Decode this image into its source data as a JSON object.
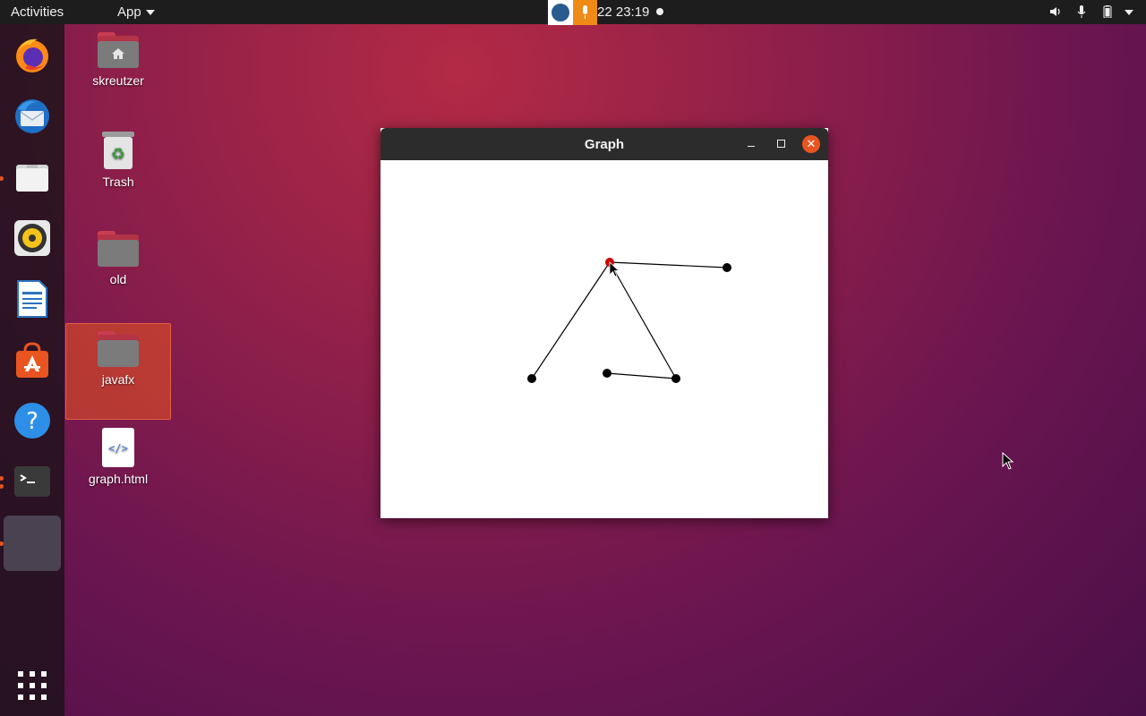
{
  "topbar": {
    "activities": "Activities",
    "app_menu": "App",
    "clock": "22  23:19"
  },
  "dock": {
    "items": [
      {
        "icon": "firefox-icon",
        "running": false
      },
      {
        "icon": "thunderbird-icon",
        "running": false
      },
      {
        "icon": "files-icon",
        "running": true
      },
      {
        "icon": "rhythmbox-icon",
        "running": false
      },
      {
        "icon": "libreoffice-writer-icon",
        "running": false
      },
      {
        "icon": "software-center-icon",
        "running": false
      },
      {
        "icon": "help-icon",
        "running": false
      },
      {
        "icon": "terminal-icon",
        "running": true,
        "instances": 2
      },
      {
        "icon": "java-app-icon",
        "running": true,
        "active": true
      }
    ],
    "show_apps_icon": "app-grid-icon"
  },
  "desktop": {
    "icons": [
      {
        "label": "skreutzer",
        "type": "home-folder"
      },
      {
        "label": "Trash",
        "type": "trash"
      },
      {
        "label": "old",
        "type": "folder"
      },
      {
        "label": "javafx",
        "type": "folder",
        "selected": true
      },
      {
        "label": "graph.html",
        "type": "html-file"
      }
    ]
  },
  "window": {
    "title": "Graph",
    "accent": "#e95420"
  },
  "graph": {
    "node_color": "#000000",
    "selected_node_color": "#cc0000",
    "edge_color": "#000000"
  }
}
